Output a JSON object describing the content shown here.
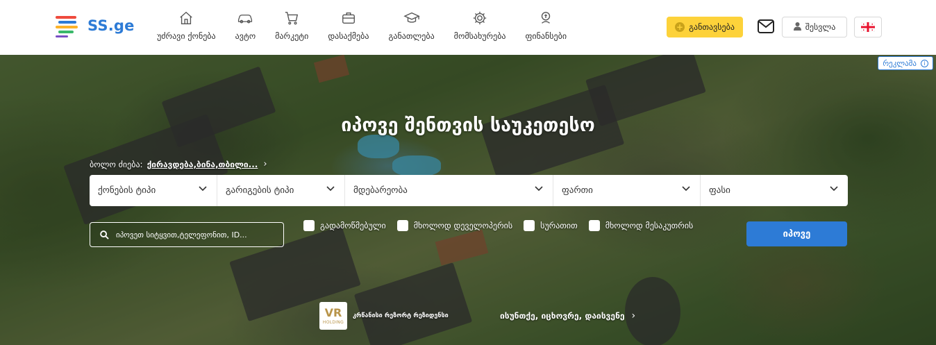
{
  "logo": {
    "text": "SS.ge",
    "bar_colors": [
      "#ef4a3d",
      "#2d7bd6",
      "#fdb32a",
      "#3ab86b",
      "#7a4fc4"
    ]
  },
  "nav": [
    {
      "label": "უძრავი ქონება",
      "icon": "house-icon"
    },
    {
      "label": "ავტო",
      "icon": "car-icon"
    },
    {
      "label": "მარკეტი",
      "icon": "cart-icon"
    },
    {
      "label": "დასაქმება",
      "icon": "briefcase-icon"
    },
    {
      "label": "განათლება",
      "icon": "graduation-cap-icon"
    },
    {
      "label": "მომსახურება",
      "icon": "gear-icon"
    },
    {
      "label": "ფინანსები",
      "icon": "finance-icon"
    }
  ],
  "header": {
    "add_label": "განთავსება",
    "login_label": "შესვლა",
    "accent_yellow": "#fdd23a",
    "accent_blue": "#2d7bd6"
  },
  "hero": {
    "ad_label": "რეკლამა",
    "title": "იპოვე შენთვის საუკეთესო",
    "recent_label": "ბოლო ძიება:",
    "recent_value": "ქირავდება,ბინა,თბილი...",
    "filters": [
      "ქონების ტიპი",
      "გარიგების ტიპი",
      "მდებარეობა",
      "ფართი",
      "ფასი"
    ],
    "search_placeholder": "იპოვეთ სიტყვით,ტელეფონით, ID...",
    "checkboxes": [
      "გადამოწმებული",
      "მხოლოდ დეველოპერის",
      "სურათით",
      "მხოლოდ მესაკუთრის"
    ],
    "find_label": "იპოვე",
    "promo": {
      "logo_main": "VR",
      "logo_sub": "HOLDING",
      "name": "კრწანისი რეზორტ რეზიდენსი",
      "tagline": "ისუნთქე, იცხოვრე, დაისვენე"
    }
  }
}
